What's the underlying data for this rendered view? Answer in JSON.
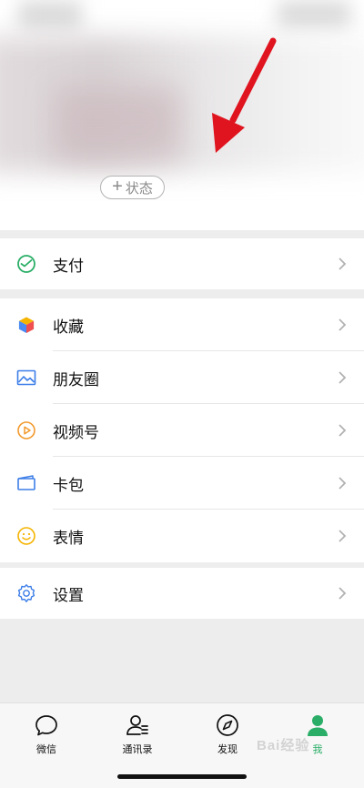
{
  "profile": {
    "status_plus": "+",
    "status_label": "状态"
  },
  "menu": {
    "pay": {
      "label": "支付",
      "icon": "pay-icon"
    },
    "collection": {
      "label": "收藏",
      "icon": "collection-cube-icon"
    },
    "moments": {
      "label": "朋友圈",
      "icon": "moments-picture-icon"
    },
    "channels": {
      "label": "视频号",
      "icon": "channels-play-icon"
    },
    "cards": {
      "label": "卡包",
      "icon": "wallet-card-icon"
    },
    "stickers": {
      "label": "表情",
      "icon": "smiley-icon"
    },
    "settings": {
      "label": "设置",
      "icon": "gear-icon"
    }
  },
  "tabbar": {
    "chats": "微信",
    "contacts": "通讯录",
    "discover": "发现",
    "me": "我"
  },
  "watermark": "Bai经验",
  "colors": {
    "accent": "#2aae67",
    "arrow": "#e0141f",
    "background": "#ededed"
  }
}
